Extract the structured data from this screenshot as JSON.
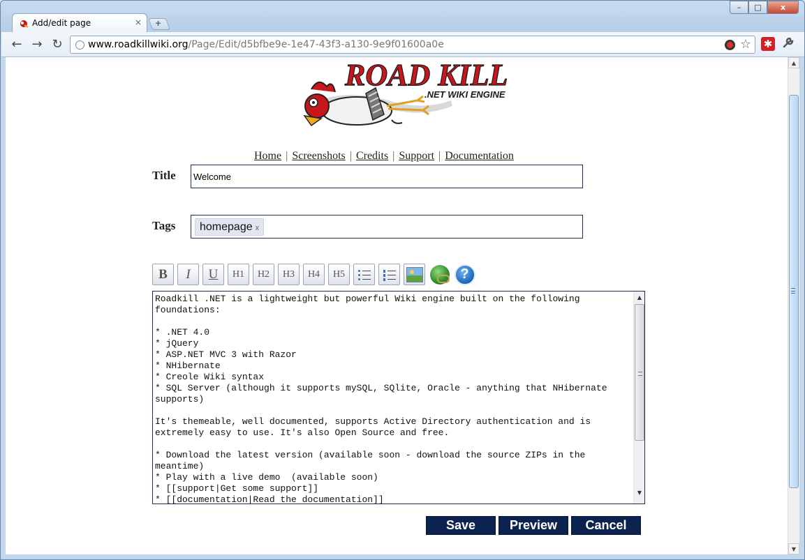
{
  "browser": {
    "tab_title": "Add/edit page",
    "tab_close": "×",
    "new_tab": "+",
    "controls": {
      "minimize": "–",
      "maximize": "□",
      "close": "x"
    },
    "nav": {
      "back": "←",
      "forward": "→",
      "reload": "↻"
    },
    "url_host": "www.roadkillwiki.org",
    "url_path": "/Page/Edit/d5bfbe9e-1e47-43f3-a130-9e9f01600a0e",
    "star": "☆",
    "extension_glyph": "✱",
    "wrench": "🔧"
  },
  "logo": {
    "title": "ROAD KILL",
    "subtitle": ".NET WIKI ENGINE",
    "colors": {
      "red": "#c8161d",
      "dark": "#1a1a1a"
    }
  },
  "site_nav": [
    "Home",
    "Screenshots",
    "Credits",
    "Support",
    "Documentation"
  ],
  "form": {
    "title_label": "Title",
    "title_value": "Welcome",
    "tags_label": "Tags",
    "tags": [
      {
        "name": "homepage",
        "remove": "x"
      }
    ],
    "editor_buttons": {
      "bold": "B",
      "italic": "I",
      "underline": "U",
      "h1": "H1",
      "h2": "H2",
      "h3": "H3",
      "h4": "H4",
      "h5": "H5",
      "help": "?"
    },
    "editor_icons": [
      "bullet-list-icon",
      "numbered-list-icon",
      "image-icon",
      "link-icon",
      "help-icon"
    ],
    "content": "Roadkill .NET is a lightweight but powerful Wiki engine built on the following foundations:\n\n* .NET 4.0\n* jQuery\n* ASP.NET MVC 3 with Razor\n* NHibernate\n* Creole Wiki syntax\n* SQL Server (although it supports mySQL, SQlite, Oracle - anything that NHibernate supports)\n\nIt's themeable, well documented, supports Active Directory authentication and is extremely easy to use. It's also Open Source and free.\n\n* Download the latest version (available soon - download the source ZIPs in the meantime)\n* Play with a live demo  (available soon)\n* [[support|Get some support]]\n* [[documentation|Read the documentation]]",
    "save_label": "Save",
    "preview_label": "Preview",
    "cancel_label": "Cancel"
  },
  "colors": {
    "button_bg": "#0c2350",
    "input_border": "#1c2f4f"
  }
}
